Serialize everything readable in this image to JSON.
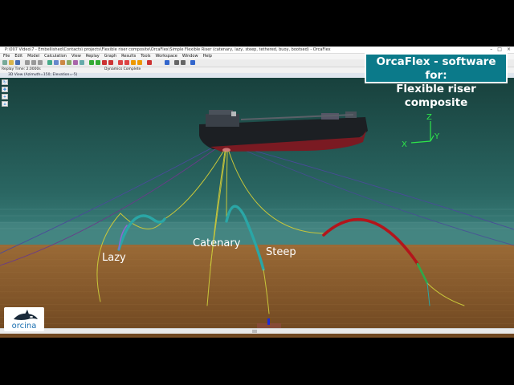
{
  "window": {
    "title": "P:\\007 Video\\7 - Embellished\\Contacts\\ projects\\Flexible riser composite\\OrcaFlex\\Simple Flexible Riser (catenary, lazy, steep, tethered, buoy, bootsed) - OrcaFlex"
  },
  "menu": [
    "File",
    "Edit",
    "Model",
    "Calculation",
    "View",
    "Replay",
    "Graph",
    "Results",
    "Tools",
    "Workspace",
    "Window",
    "Help"
  ],
  "status": {
    "replay_time": "Replay Time: 2.0000s",
    "dynamics": "Dynamics Complete"
  },
  "view_header": "3D View (Azimuth=150; Elevation=-5)",
  "overlay": {
    "line1": "OrcaFlex - software for:",
    "line2": "Flexible riser composite"
  },
  "axes": {
    "z": "Z",
    "y": "Y",
    "x": "X"
  },
  "riser_labels": {
    "lazy": "Lazy",
    "catenary": "Catenary",
    "steep": "Steep"
  },
  "logo": {
    "text": "orcina"
  },
  "colors": {
    "sea_top": "#1c4a45",
    "sea_mid": "#2d6c68",
    "seabed": "#8a5b2e",
    "buoyancy_cyan": "#2aa6a6",
    "buoyancy_red": "#b3151b",
    "riser_yellow": "#c8c63a",
    "mooring_blue": "#4a4a9a",
    "brand_teal": "#0b7a8a"
  }
}
